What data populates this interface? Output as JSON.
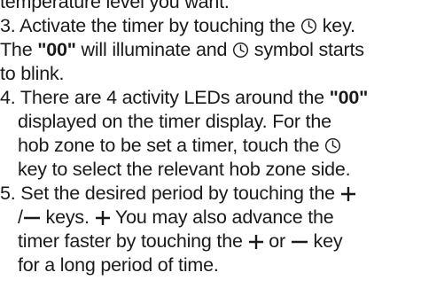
{
  "document": {
    "line0": "temperature level you want.",
    "step3": {
      "l1a": "3. Activate the timer by touching the ",
      "l1b": " key.",
      "l2a": "The ",
      "l2bold": "\"00\"",
      "l2b": " will illuminate and ",
      "l2c": " symbol starts",
      "l3": "to blink."
    },
    "step4": {
      "l1a": "4. There are 4 activity LEDs around the ",
      "l1bold": "\"00\"",
      "l2": "displayed on the timer display. For the",
      "l3a": "hob zone to be set a timer, touch the ",
      "l4": "key to select the relevant hob zone side."
    },
    "step5": {
      "l1a": "5. Set the desired period by touching the ",
      "l2a": "/",
      "l2b": " keys. ",
      "l2c": " You may also advance the",
      "l3": "timer faster by touching the ",
      "l3b": " or ",
      "l3c": " key",
      "l4": "for a long period of time."
    }
  },
  "icons": {
    "timer": "clock-icon",
    "plus": "plus-icon",
    "minus": "minus-icon"
  }
}
